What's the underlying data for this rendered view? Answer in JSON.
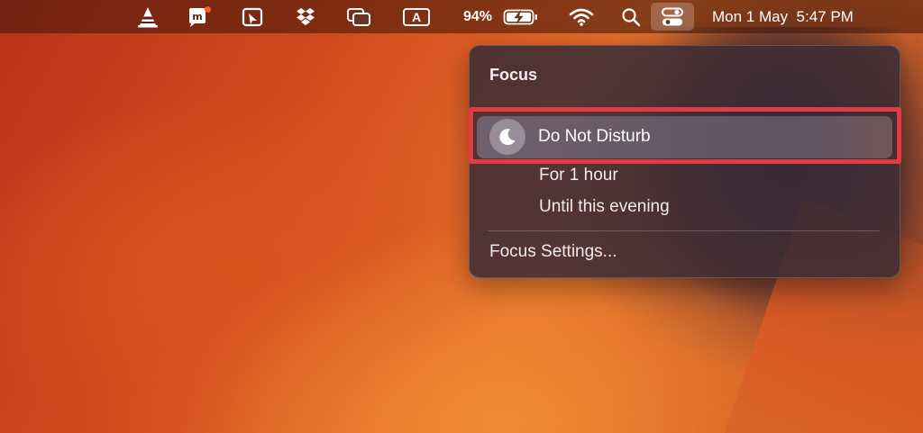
{
  "menubar": {
    "icons": [
      "vlc-cone-icon",
      "messenger-bubble-icon",
      "pointer-tool-icon",
      "dropbox-icon",
      "window-overlap-icon",
      "input-source-icon",
      "battery-icon",
      "wifi-icon",
      "spotlight-search-icon",
      "control-center-icon"
    ],
    "input_source_label": "A",
    "battery_percent": "94%",
    "clock": "Mon 1 May  5:47 PM"
  },
  "focus_panel": {
    "title": "Focus",
    "do_not_disturb": {
      "label": "Do Not Disturb",
      "icon": "moon-icon"
    },
    "options": [
      "For 1 hour",
      "Until this evening"
    ],
    "settings_label": "Focus Settings..."
  },
  "colors": {
    "highlight": "#e23b45",
    "badge": "#ff5a1f"
  }
}
